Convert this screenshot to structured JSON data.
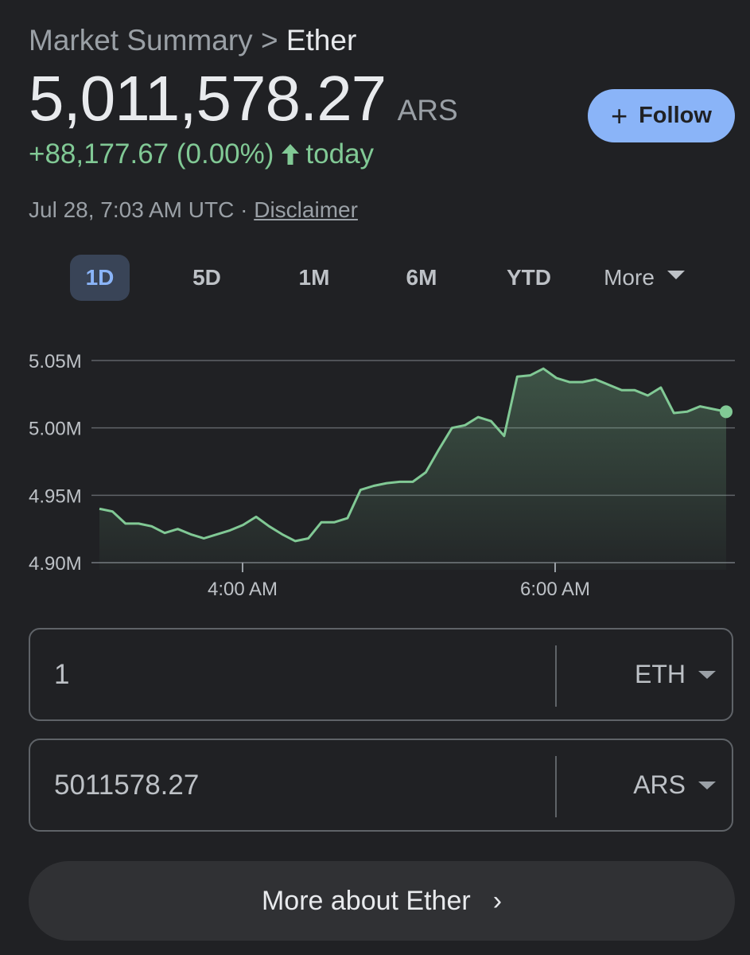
{
  "header": {
    "breadcrumb_parent": "Market Summary",
    "breadcrumb_sep": ">",
    "breadcrumb_current": "Ether",
    "price": "5,011,578.27",
    "currency": "ARS",
    "follow_label": "Follow",
    "change": "+88,177.67 (0.00%)",
    "change_suffix": "today",
    "timestamp": "Jul 28, 7:03 AM UTC",
    "meta_sep": "·",
    "disclaimer": "Disclaimer"
  },
  "range_tabs": [
    {
      "label": "1D",
      "active": true
    },
    {
      "label": "5D",
      "active": false
    },
    {
      "label": "1M",
      "active": false
    },
    {
      "label": "6M",
      "active": false
    },
    {
      "label": "YTD",
      "active": false
    },
    {
      "label": "More",
      "active": false
    }
  ],
  "chart_data": {
    "type": "area",
    "y_ticks": [
      "5.05M",
      "5.00M",
      "4.95M",
      "4.90M"
    ],
    "x_ticks": [
      "4:00 AM",
      "6:00 AM"
    ],
    "ylim": [
      4.9,
      5.05
    ],
    "unit": "M ARS",
    "line_color": "#81c995",
    "x": [
      0,
      1,
      2,
      3,
      4,
      5,
      6,
      7,
      8,
      9,
      10,
      11,
      12,
      13,
      14,
      15,
      16,
      17,
      18,
      19,
      20,
      21,
      22,
      23,
      24,
      25,
      26,
      27,
      28,
      29,
      30,
      31,
      32,
      33,
      34,
      35,
      36,
      37,
      38,
      39,
      40,
      41,
      42,
      43,
      44,
      45,
      46,
      47,
      48,
      49,
      50,
      51,
      52,
      53,
      54,
      55,
      56,
      57,
      58,
      59,
      60,
      61,
      62,
      63,
      64,
      65,
      66
    ],
    "values": [
      4.94,
      4.938,
      4.929,
      4.929,
      4.927,
      4.922,
      4.925,
      4.921,
      4.918,
      4.921,
      4.924,
      4.928,
      4.934,
      4.927,
      4.921,
      4.916,
      4.918,
      4.93,
      4.93,
      4.933,
      4.954,
      4.957,
      4.959,
      4.96,
      4.96,
      4.967,
      4.984,
      5.0,
      5.002,
      5.008,
      5.005,
      4.994,
      5.038,
      5.039,
      5.044,
      5.037,
      5.034,
      5.034,
      5.036,
      5.032,
      5.028,
      5.028,
      5.024,
      5.03,
      5.011,
      5.012,
      5.016,
      5.014,
      5.012,
      5.012,
      5.012,
      5.012,
      5.012,
      5.012,
      5.012,
      5.012,
      5.012,
      5.012,
      5.012,
      5.012,
      5.012,
      5.012,
      5.012,
      5.012,
      5.012,
      5.012,
      5.012
    ]
  },
  "converter": {
    "from_value": "1",
    "from_unit": "ETH",
    "to_value": "5011578.27",
    "to_unit": "ARS"
  },
  "footer": {
    "more_label": "More about Ether"
  }
}
